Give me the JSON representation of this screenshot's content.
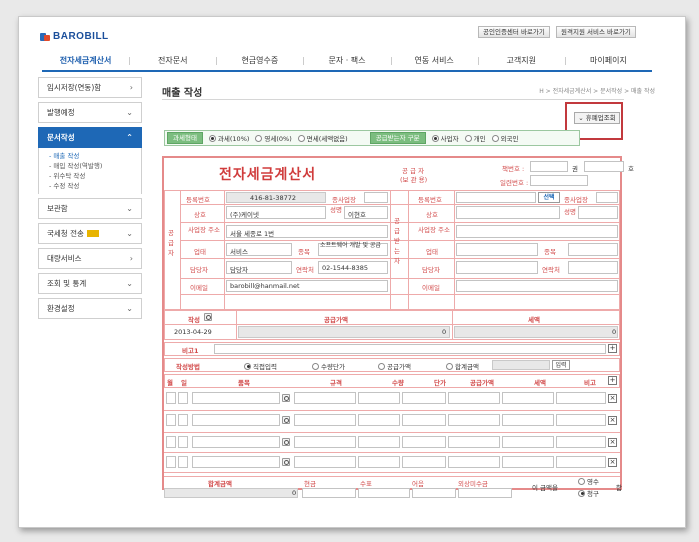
{
  "logo": "BAROBILL",
  "top_buttons": [
    "공인인증센터 바로가기",
    "원격지원 서비스 바로가기"
  ],
  "nav": [
    "전자세금계산서",
    "전자문서",
    "현금영수증",
    "문자 · 팩스",
    "연동 서비스",
    "고객지원",
    "마이페이지"
  ],
  "sidebar": {
    "items_top": [
      "임시저장(연동)함",
      "발행예정",
      "문서작성"
    ],
    "sub": [
      "- 매출 작성",
      "- 매입 작성(역발행)",
      "- 위수탁 작성",
      "- 수정 작성"
    ],
    "items_bottom": [
      "보관함",
      "국세청 전송",
      "대량서비스",
      "조회 및 통계",
      "환경설정"
    ]
  },
  "page": {
    "title": "매출 작성",
    "breadcrumb": "H > 전자세금계산서 > 문서작성 > 매출 작성",
    "search_button": "휴폐업조회"
  },
  "typebar": {
    "tax_label": "과세형태",
    "tax_options": [
      "과세(10%)",
      "영세(0%)",
      "면세(세액없음)"
    ],
    "buyer_label": "공급받는자 구분",
    "buyer_options": [
      "사업자",
      "개인",
      "외국인"
    ]
  },
  "invoice": {
    "title": "전자세금계산서",
    "supplier_tag": "공 급 자",
    "supplier_tag2": "(보 관 용)",
    "book_no_label": "책번호 :",
    "book_vol": "권",
    "book_ho": "호",
    "serial_label": "일련번호 :",
    "supplier_side": [
      "공",
      "급",
      "자"
    ],
    "buyer_side": [
      "공",
      "급",
      "받",
      "는",
      "자"
    ],
    "labels": {
      "reg_no": "등록번호",
      "branch": "종사업장",
      "company": "상호",
      "name": "성명",
      "address": "사업장 주소",
      "biz_type": "업태",
      "biz_item": "종목",
      "manager": "담당자",
      "contact": "연락처",
      "email": "이메일",
      "select": "선택"
    },
    "supplier": {
      "reg_no": "416-81-38772",
      "company": "(주)케이넷",
      "name": "이현호",
      "address": "서울 세종로 1번",
      "biz_type": "서비스",
      "biz_item": "소프트웨어 개발 및 공급",
      "manager": "담당자",
      "contact": "02-1544-8385",
      "email": "barobill@hanmail.net"
    },
    "date_label": "작성",
    "supply_label": "공급가액",
    "tax_label": "세액",
    "date_value": "2013-04-29",
    "supply_value": "0",
    "tax_value": "0",
    "note_label": "비고1",
    "method_label": "작성방법",
    "method_options": [
      "직접입력",
      "수량단가",
      "공급가액",
      "합계금액"
    ],
    "input_button": "입력",
    "item_headers": [
      "월",
      "일",
      "품목",
      "규격",
      "수량",
      "단가",
      "공급가액",
      "세액",
      "비고"
    ],
    "total_headers": [
      "합계금액",
      "현금",
      "수표",
      "어음",
      "외상미수금"
    ],
    "total_value": "0",
    "amount_text": "이 금액을",
    "amount_options": [
      "영수",
      "청구"
    ],
    "amount_suffix": "함"
  },
  "colors": {
    "accent": "#1e68b6",
    "invoice_red": "#d03c3c",
    "highlight": "#c2393d",
    "green": "#7bbd7f"
  }
}
